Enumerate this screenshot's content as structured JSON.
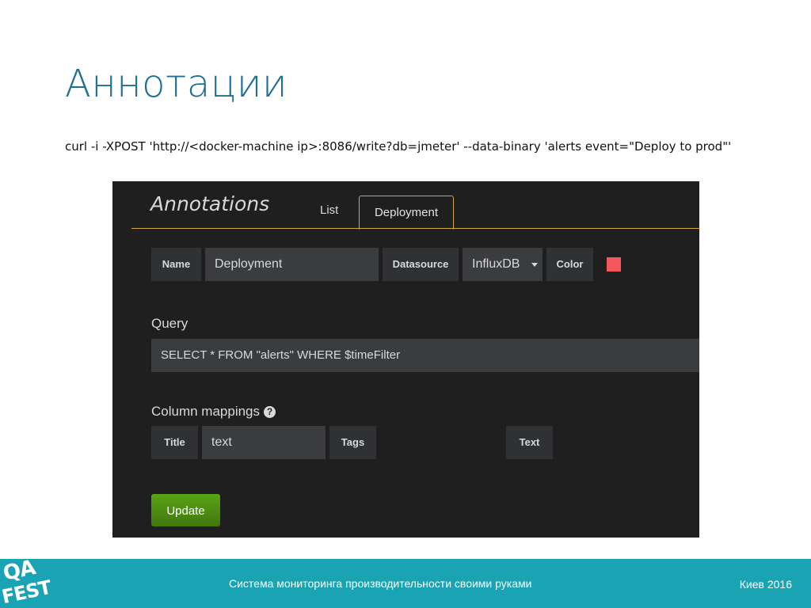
{
  "slide": {
    "title": "Аннотации",
    "command": "curl -i -XPOST 'http://<docker-machine ip>:8086/write?db=jmeter' --data-binary 'alerts event=\"Deploy to prod\"'"
  },
  "grafana": {
    "panel_title": "Annotations",
    "tabs": [
      {
        "label": "List",
        "active": false
      },
      {
        "label": "Deployment",
        "active": true
      }
    ],
    "name_label": "Name",
    "name_value": "Deployment",
    "datasource_label": "Datasource",
    "datasource_value": "InfluxDB",
    "color_label": "Color",
    "color_value": "#f4585e",
    "query_label": "Query",
    "query_value": "SELECT * FROM \"alerts\" WHERE $timeFilter",
    "column_mappings_label": "Column mappings",
    "help_glyph": "?",
    "title_label": "Title",
    "title_value": "text",
    "tags_label": "Tags",
    "tags_value": "",
    "text_label": "Text",
    "text_value": "",
    "update_button": "Update",
    "accent_color": "#d8a43c",
    "button_color": "#4e8b11"
  },
  "footer": {
    "logo_line1": "QA",
    "logo_line2": "FEST",
    "subtitle": "Система мониторинга производительности своими руками",
    "location": "Киев 2016",
    "color": "#1aa3b2"
  }
}
